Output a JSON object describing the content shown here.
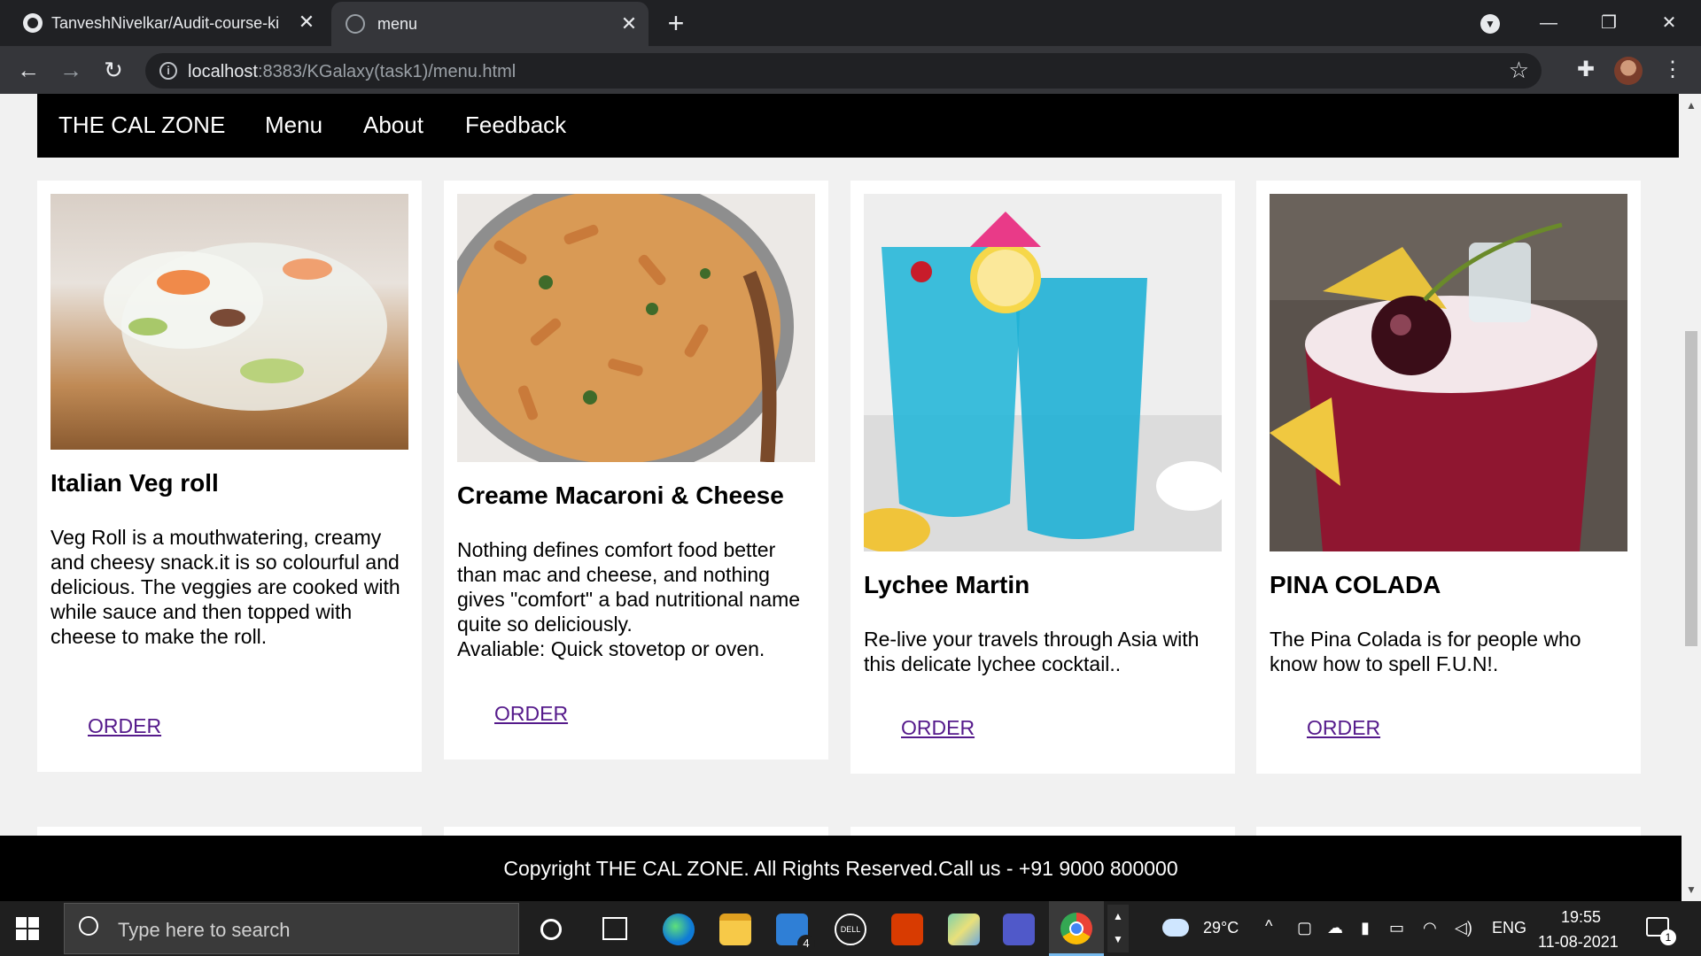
{
  "browser": {
    "tabs": [
      {
        "title": "TanveshNivelkar/Audit-course-ki"
      },
      {
        "title": "menu"
      }
    ],
    "url_host": "localhost",
    "url_path": ":8383/KGalaxy(task1)/menu.html"
  },
  "site": {
    "brand": "THE CAL ZONE",
    "nav": [
      "Menu",
      "About",
      "Feedback"
    ],
    "footer": "Copyright THE CAL ZONE. All Rights Reserved.Call us - +91 9000 800000"
  },
  "cards": [
    {
      "title": "Italian Veg roll",
      "description": "Veg Roll is a mouthwatering, creamy and cheesy snack.it is so colourful and delicious. The veggies are cooked with while sauce and then topped with cheese to make the roll.",
      "order": "ORDER"
    },
    {
      "title": "Creame Macaroni & Cheese",
      "description": "Nothing defines comfort food better than mac and cheese, and nothing gives \"comfort\" a bad nutritional name quite so deliciously.",
      "extra": "Avaliable: Quick stovetop or oven.",
      "order": "ORDER"
    },
    {
      "title": "Lychee Martin",
      "description": "Re-live your travels through Asia with this delicate lychee cocktail..",
      "order": "ORDER"
    },
    {
      "title": "PINA COLADA",
      "description": "The Pina Colada is for people who know how to spell F.U.N!.",
      "order": "ORDER"
    }
  ],
  "taskbar": {
    "search_placeholder": "Type here to search",
    "weather": "29°C",
    "language": "ENG",
    "time": "19:55",
    "date": "11-08-2021",
    "mail_badge": "4",
    "notification_badge": "1"
  }
}
